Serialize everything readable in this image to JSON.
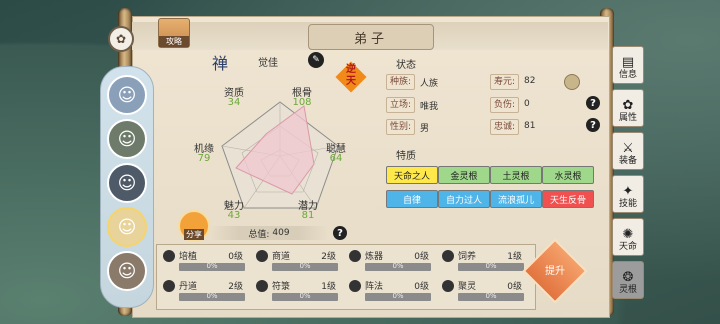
{
  "header": {
    "title": "弟子",
    "guide_label": "攻略"
  },
  "disciple": {
    "name": "觉佳",
    "rank_badge": "禅",
    "gender_badge": "逆天"
  },
  "stats": {
    "aptitude": {
      "label": "资质",
      "value": "34"
    },
    "root_bone": {
      "label": "根骨",
      "value": "108"
    },
    "fortune": {
      "label": "机缘",
      "value": "79"
    },
    "intelligence": {
      "label": "聪慧",
      "value": "64"
    },
    "charm": {
      "label": "魅力",
      "value": "43"
    },
    "potential": {
      "label": "潜力",
      "value": "81"
    },
    "total_label": "总值:",
    "total_value": "409",
    "share_label": "分享"
  },
  "status": {
    "section_title": "状态",
    "race_label": "种族:",
    "race_value": "人族",
    "lifespan_label": "寿元:",
    "lifespan_value": "82",
    "stance_label": "立场:",
    "stance_value": "唯我",
    "injury_label": "负伤:",
    "injury_value": "0",
    "gender_label": "性别:",
    "gender_value": "男",
    "loyalty_label": "忠诚:",
    "loyalty_value": "81"
  },
  "traits": {
    "section_title": "特质",
    "items": [
      {
        "label": "天命之人",
        "color": "#ffe94a"
      },
      {
        "label": "金灵根",
        "color": "#9fd88a"
      },
      {
        "label": "土灵根",
        "color": "#9fd88a"
      },
      {
        "label": "水灵根",
        "color": "#9fd88a"
      },
      {
        "label": "自律",
        "color": "#4fb4e8"
      },
      {
        "label": "自力过人",
        "color": "#4fb4e8"
      },
      {
        "label": "流浪孤儿",
        "color": "#4fb4e8"
      },
      {
        "label": "天生反骨",
        "color": "#f05050"
      }
    ]
  },
  "skills": [
    {
      "name": "培植",
      "level": "0级",
      "percent": "0%"
    },
    {
      "name": "商道",
      "level": "2级",
      "percent": "0%"
    },
    {
      "name": "炼器",
      "level": "0级",
      "percent": "0%"
    },
    {
      "name": "饲养",
      "level": "1级",
      "percent": "0%"
    },
    {
      "name": "丹道",
      "level": "2级",
      "percent": "0%"
    },
    {
      "name": "符箓",
      "level": "1级",
      "percent": "0%"
    },
    {
      "name": "阵法",
      "level": "0级",
      "percent": "0%"
    },
    {
      "name": "聚灵",
      "level": "0级",
      "percent": "0%"
    }
  ],
  "upgrade_label": "提升",
  "tabs": [
    {
      "label": "信息"
    },
    {
      "label": "属性"
    },
    {
      "label": "装备"
    },
    {
      "label": "技能"
    },
    {
      "label": "天命"
    },
    {
      "label": "灵根"
    }
  ]
}
